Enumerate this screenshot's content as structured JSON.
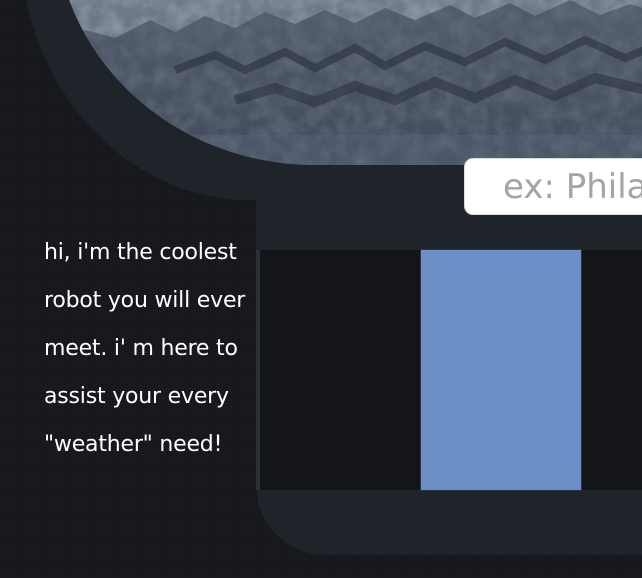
{
  "intro": {
    "text": "hi, i'm the coolest robot you will ever meet. i' m here to assist your every \"weather\" need!"
  },
  "search": {
    "placeholder": "ex: Philadelphia",
    "value": ""
  },
  "weather_panel": {
    "bar_color": "#6b8fc6"
  },
  "theme": {
    "background": "#15171b",
    "robot_color": "#1f232a",
    "screen_color": "#131519"
  }
}
